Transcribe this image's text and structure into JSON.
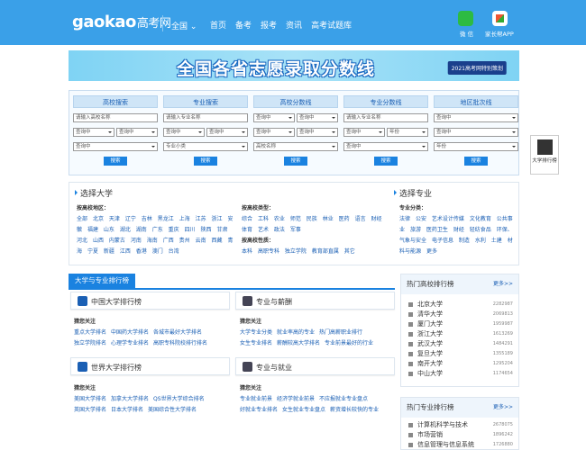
{
  "header": {
    "logo_en": "gaokao",
    "logo_cn": "高考网",
    "region": "全国 ⌄",
    "nav": [
      "首页",
      "备考",
      "报考",
      "资讯",
      "高考试题库"
    ],
    "wechat_label": "微 信",
    "app_label": "家长帮APP"
  },
  "banner": {
    "title": "全国各省志愿录取分数线",
    "tag": "2021高考网特别策划"
  },
  "search": {
    "columns": [
      {
        "title": "高校搜索",
        "row1": "请输入高校名称",
        "row2a": "查询中",
        "row2b": "查询中",
        "row3": "查询中",
        "button": "搜索"
      },
      {
        "title": "专业搜索",
        "row1": "请输入专业名称",
        "row2a": "查询中",
        "row2b": "查询中",
        "row3": "专业小类",
        "button": "搜索"
      },
      {
        "title": "高校分数线",
        "row1a": "查询中",
        "row1b": "查询中",
        "row2a": "查询中",
        "row2b": "查询中",
        "row3": "高校名称",
        "button": "搜索"
      },
      {
        "title": "专业分数线",
        "row1": "请输入专业名称",
        "row2a": "查询中",
        "row2b": "年份",
        "row3": "查询中",
        "button": "搜索"
      },
      {
        "title": "地区批次线",
        "row1": "查询中",
        "row2": "查询中",
        "row3": "年份",
        "button": "搜索"
      }
    ]
  },
  "side": {
    "label": "大学排行榜"
  },
  "choose": {
    "left_title": "选择大学",
    "right_title": "选择专业",
    "region_label": "按高校地区：",
    "regions": [
      "全部",
      "北京",
      "天津",
      "辽宁",
      "吉林",
      "黑龙江",
      "上海",
      "江苏",
      "浙江",
      "安徽",
      "福建",
      "山东",
      "湖北",
      "湖南",
      "广东",
      "重庆",
      "四川",
      "陕西",
      "甘肃",
      "河北",
      "山西",
      "内蒙古",
      "河南",
      "海南",
      "广西",
      "贵州",
      "云南",
      "西藏",
      "青海",
      "宁夏",
      "新疆",
      "江西",
      "香港",
      "澳门",
      "台湾"
    ],
    "type_label": "按高校类型：",
    "types": [
      "综合",
      "工科",
      "农业",
      "师范",
      "民族",
      "林业",
      "医药",
      "语言",
      "财经",
      "体育",
      "艺术",
      "政法",
      "军事"
    ],
    "nature_label": "按高校性质：",
    "natures": [
      "本科",
      "高职专科",
      "独立学院",
      "教育部直属",
      "其它"
    ],
    "major_label": "专业分类：",
    "majors": [
      "法律",
      "公安",
      "艺术设计传媒",
      "文化教育",
      "公共事业",
      "旅游",
      "医药卫生",
      "财经",
      "轻纺食品",
      "环保、气象与安全",
      "电子信息",
      "制造",
      "水利",
      "土建",
      "材料与能源",
      "更多"
    ]
  },
  "ranking_section": {
    "tab": "大学与专业排行榜",
    "cards": [
      {
        "title": "中国大学排行榜",
        "follow": "猜您关注",
        "links": [
          "重点大学排名",
          "中国药大学排名",
          "各城市最好大学排名",
          "独立学院排名",
          "心理学专业排名",
          "高职专科院校排行排名"
        ]
      },
      {
        "title": "专业与薪酬",
        "follow": "猜您关注",
        "links": [
          "大学专业分类",
          "就业率高的专业",
          "热门高薪职业排行",
          "女生专业排名",
          "薪酬较高大学排名",
          "专业前景最好的行业"
        ]
      },
      {
        "title": "世界大学排行榜",
        "follow": "猜您关注",
        "links": [
          "美国大学排名",
          "加拿大大学排名",
          "QS世界大学综合排名",
          "英国大学排名",
          "日本大学排名",
          "美国综合性大学排名"
        ]
      },
      {
        "title": "专业与就业",
        "follow": "猜您关注",
        "links": [
          "专业就业前景",
          "经济学就业前景",
          "不应报就业专业盘点",
          "好就业专业排名",
          "女生就业专业盘点",
          "薪资增长较快的专业"
        ]
      }
    ]
  },
  "hot_colleges": {
    "title": "热门高校排行榜",
    "more": "更多>>",
    "items": [
      {
        "name": "北京大学",
        "count": "2282987"
      },
      {
        "name": "清华大学",
        "count": "2069813"
      },
      {
        "name": "厦门大学",
        "count": "1959987"
      },
      {
        "name": "浙江大学",
        "count": "1613269"
      },
      {
        "name": "武汉大学",
        "count": "1484291"
      },
      {
        "name": "复旦大学",
        "count": "1355189"
      },
      {
        "name": "南开大学",
        "count": "1295204"
      },
      {
        "name": "中山大学",
        "count": "1174654"
      }
    ]
  },
  "hot_majors": {
    "title": "热门专业排行榜",
    "more": "更多>>",
    "items": [
      {
        "name": "计算机科学与技术",
        "count": "2678075"
      },
      {
        "name": "市场营销",
        "count": "1896242"
      },
      {
        "name": "信息管理与信息系统",
        "count": "1726880"
      }
    ]
  }
}
